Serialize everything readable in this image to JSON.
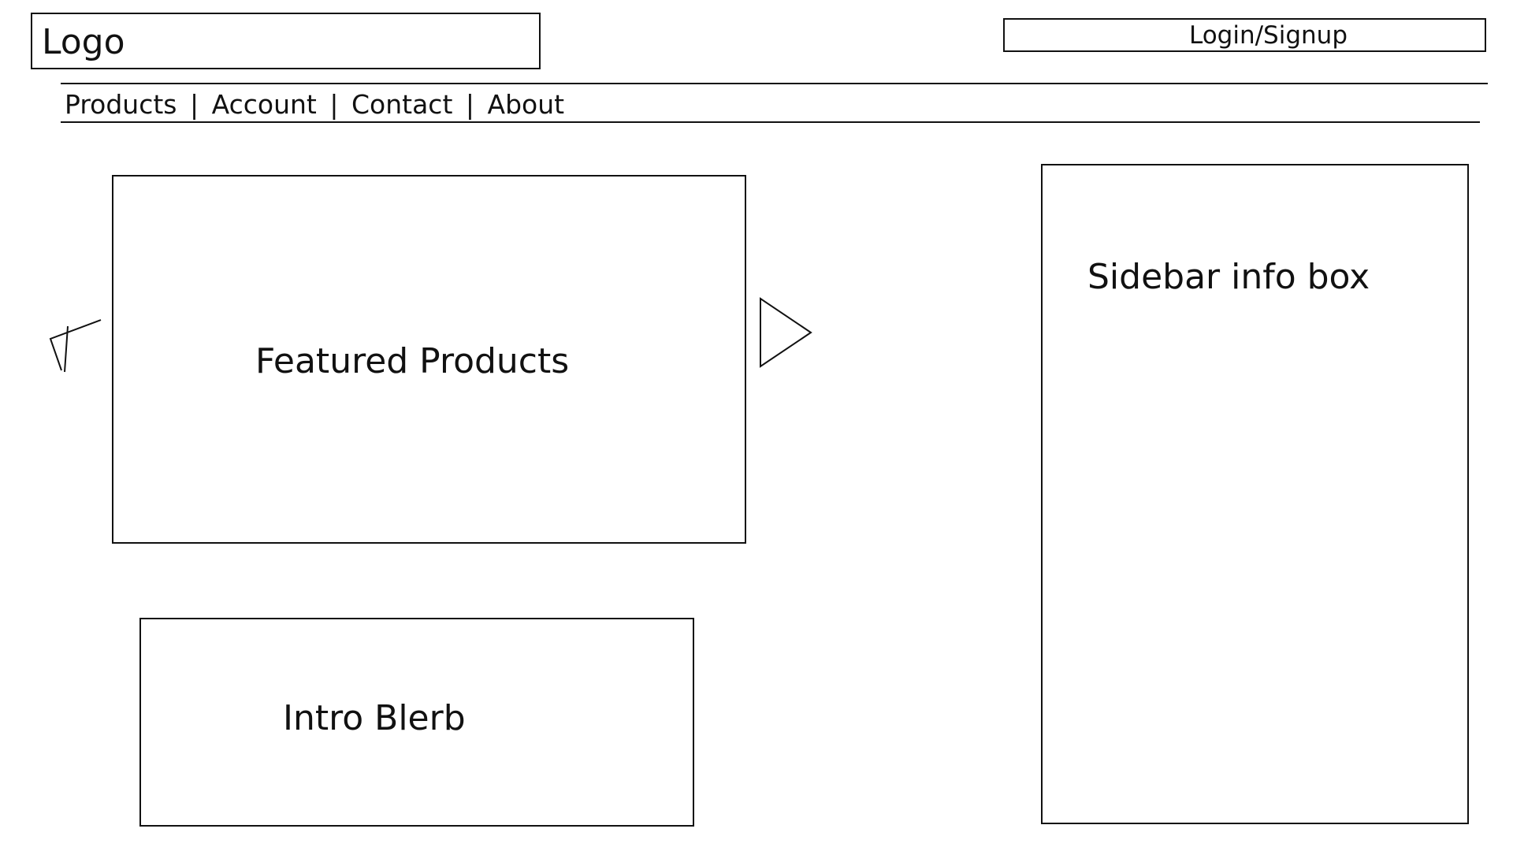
{
  "header": {
    "logo": "Logo",
    "login_label": "Login/Signup"
  },
  "nav": {
    "items": [
      "Products",
      "Account",
      "Contact",
      "About"
    ],
    "separator": "|"
  },
  "main": {
    "featured_label": "Featured Products",
    "intro_label": "Intro Blerb"
  },
  "sidebar": {
    "label": "Sidebar info box"
  },
  "icons": {
    "prev": "carousel-prev-arrow-icon",
    "next": "carousel-next-arrow-icon"
  }
}
